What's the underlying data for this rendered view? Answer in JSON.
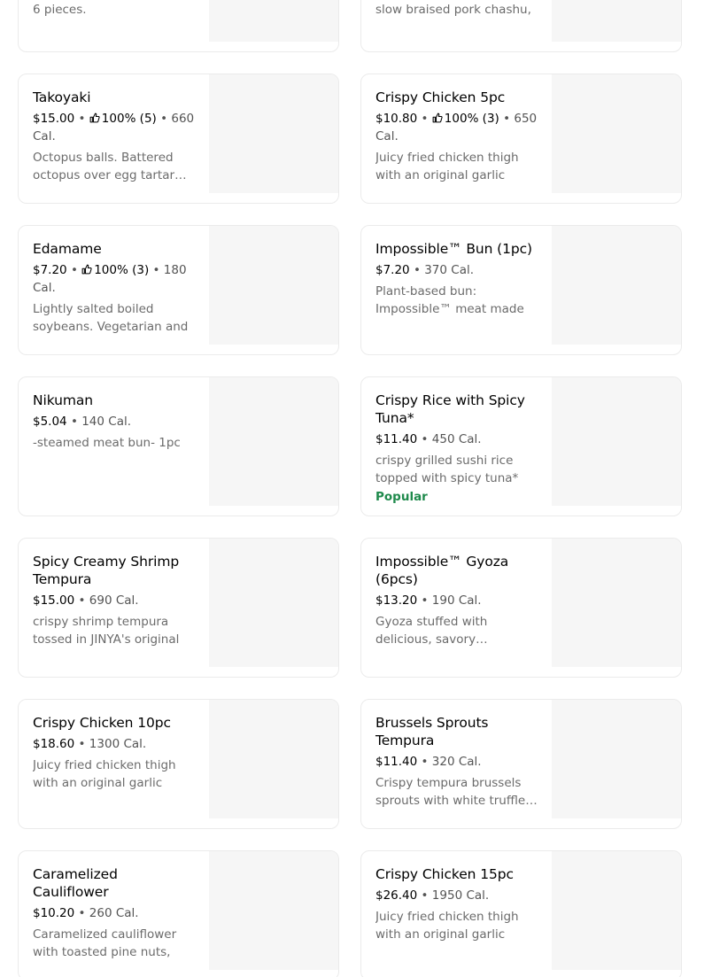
{
  "menu_items": [
    {
      "name": "",
      "price": "",
      "rating": "",
      "calories": "",
      "description": "6 pieces.",
      "badge": ""
    },
    {
      "name": "",
      "price": "",
      "rating": "",
      "calories": "",
      "description": "slow braised pork chashu,",
      "badge": ""
    },
    {
      "name": "Takoyaki",
      "price": "$15.00",
      "rating": "100% (5)",
      "calories": "660 Cal.",
      "description": "Octopus balls. Battered octopus over egg tartar sauce.",
      "badge": ""
    },
    {
      "name": "Crispy Chicken 5pc",
      "price": "$10.80",
      "rating": "100% (3)",
      "calories": "650 Cal.",
      "description": "Juicy fried chicken thigh with an original garlic",
      "badge": ""
    },
    {
      "name": "Edamame",
      "price": "$7.20",
      "rating": "100% (3)",
      "calories": "180 Cal.",
      "description": "Lightly salted boiled soybeans. Vegetarian and",
      "badge": ""
    },
    {
      "name": "Impossible™ Bun (1pc)",
      "price": "$7.20",
      "rating": "",
      "calories": "370 Cal.",
      "description": "Plant-based bun: Impossible™ meat made",
      "badge": ""
    },
    {
      "name": "Nikuman",
      "price": "$5.04",
      "rating": "",
      "calories": "140 Cal.",
      "description": "-steamed meat bun- 1pc",
      "badge": ""
    },
    {
      "name": "Crispy Rice with Spicy Tuna*",
      "price": "$11.40",
      "rating": "",
      "calories": "450 Cal.",
      "description": "crispy grilled sushi rice topped with spicy tuna*",
      "badge": "Popular"
    },
    {
      "name": "Spicy Creamy Shrimp Tempura",
      "price": "$15.00",
      "rating": "",
      "calories": "690 Cal.",
      "description": "crispy shrimp tempura tossed in JINYA's original",
      "badge": ""
    },
    {
      "name": "Impossible™ Gyoza (6pcs)",
      "price": "$13.20",
      "rating": "",
      "calories": "190 Cal.",
      "description": "Gyoza stuffed with delicious, savory Impossible™ meat",
      "badge": ""
    },
    {
      "name": "Crispy Chicken 10pc",
      "price": "$18.60",
      "rating": "",
      "calories": "1300 Cal.",
      "description": "Juicy fried chicken thigh with an original garlic",
      "badge": ""
    },
    {
      "name": "Brussels Sprouts Tempura",
      "price": "$11.40",
      "rating": "",
      "calories": "320 Cal.",
      "description": "Crispy tempura brussels sprouts with white truffle oil",
      "badge": ""
    },
    {
      "name": "Caramelized Cauliflower",
      "price": "$10.20",
      "rating": "",
      "calories": "260 Cal.",
      "description": "Caramelized cauliflower with toasted pine nuts,",
      "badge": ""
    },
    {
      "name": "Crispy Chicken 15pc",
      "price": "$26.40",
      "rating": "",
      "calories": "1950 Cal.",
      "description": "Juicy fried chicken thigh with an original garlic",
      "badge": ""
    }
  ],
  "colors": {
    "popular_badge": "#1f8a4c",
    "image_placeholder": "#f6f6f6",
    "card_border": "#ebebeb"
  },
  "icons": {
    "rating": "thumbs-up-icon"
  }
}
